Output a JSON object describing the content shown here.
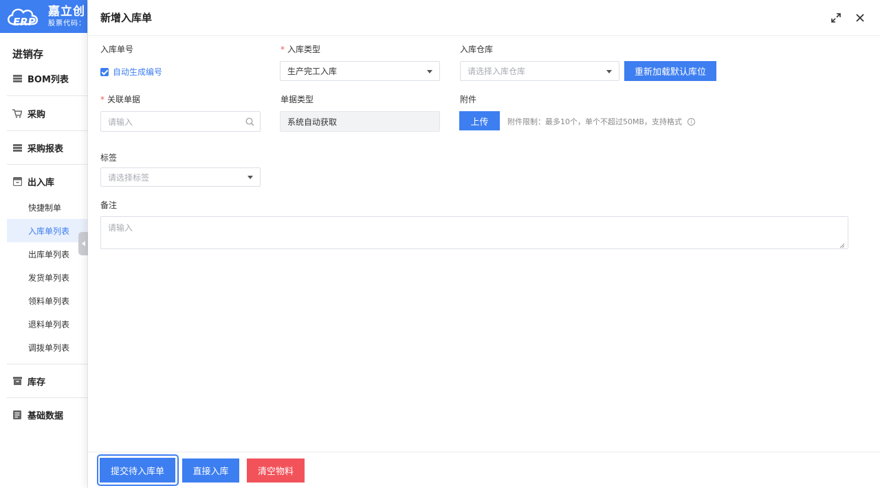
{
  "brand": {
    "name": "嘉立创",
    "stock_code_label": "股票代码：",
    "logo_text": "ERP"
  },
  "sidebar": {
    "title": "进销存",
    "groups": [
      {
        "label": "BOM列表",
        "icon": "list-icon"
      },
      {
        "label": "采购",
        "icon": "cart-icon"
      },
      {
        "label": "采购报表",
        "icon": "list-icon"
      },
      {
        "label": "出入库",
        "icon": "box-icon"
      },
      {
        "label": "库存",
        "icon": "archive-icon"
      },
      {
        "label": "基础数据",
        "icon": "document-icon"
      }
    ],
    "sub_items": [
      "快捷制单",
      "入库单列表",
      "出库单列表",
      "发货单列表",
      "领料单列表",
      "退料单列表",
      "调拨单列表"
    ],
    "active_sub_item": "入库单列表"
  },
  "panel": {
    "title": "新增入库单",
    "fields": {
      "order_no": {
        "label": "入库单号",
        "checkbox_label": "自动生成编号",
        "checked": true
      },
      "in_type": {
        "label": "入库类型",
        "required": true,
        "value": "生产完工入库"
      },
      "warehouse": {
        "label": "入库仓库",
        "placeholder": "请选择入库仓库"
      },
      "reload_button": "重新加载默认库位",
      "related_doc": {
        "label": "关联单据",
        "required": true,
        "placeholder": "请输入"
      },
      "doc_type": {
        "label": "单据类型",
        "value": "系统自动获取"
      },
      "attachment": {
        "label": "附件",
        "upload_button": "上传",
        "hint": "附件限制：最多10个，单个不超过50MB，支持格式"
      },
      "tags": {
        "label": "标签",
        "placeholder": "请选择标签"
      },
      "remark": {
        "label": "备注",
        "placeholder": "请输入"
      }
    },
    "footer": {
      "submit_pending": "提交待入库单",
      "direct_in": "直接入库",
      "clear_materials": "清空物料"
    }
  },
  "colors": {
    "primary": "#3d7ef0",
    "danger": "#f2535b",
    "required": "#f25b5b"
  }
}
